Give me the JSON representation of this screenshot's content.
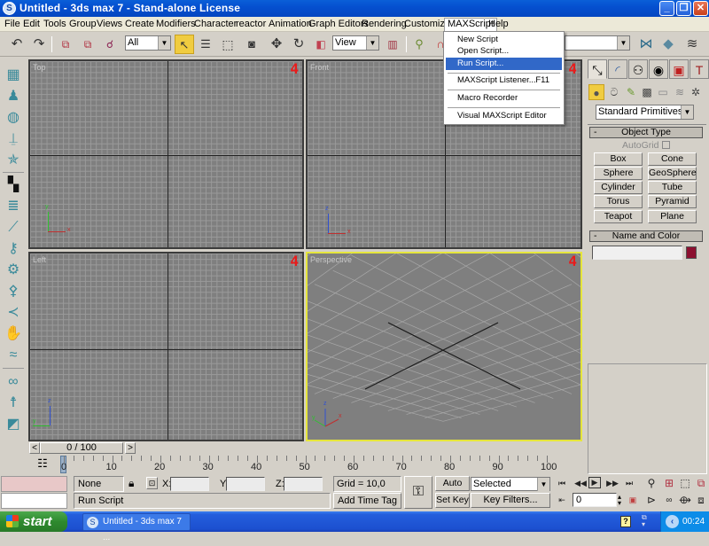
{
  "window": {
    "title": "Untitled - 3ds max 7  - Stand-alone License",
    "app_icon": "3ds-max-logo-icon",
    "controls": [
      "minimize",
      "restore",
      "close"
    ]
  },
  "menubar": {
    "items": [
      "File",
      "Edit",
      "Tools",
      "Group",
      "Views",
      "Create",
      "Modifiers",
      "Character",
      "reactor",
      "Animation",
      "Graph Editors",
      "Rendering",
      "Customize",
      "MAXScript",
      "Help"
    ],
    "open_menu": "MAXScript"
  },
  "maxscript_menu": {
    "items": [
      {
        "label": "New Script",
        "shortcut": ""
      },
      {
        "label": "Open Script...",
        "shortcut": ""
      },
      {
        "label": "Run Script...",
        "shortcut": "",
        "highlighted": true
      },
      {
        "label": "MAXScript Listener...",
        "shortcut": "F11"
      },
      {
        "label": "Macro Recorder",
        "shortcut": ""
      },
      {
        "label": "Visual MAXScript Editor",
        "shortcut": ""
      }
    ]
  },
  "toolbar": {
    "selection_filter": "All",
    "ref_coord_system": "View",
    "named_selection": "",
    "icons": [
      "undo-icon",
      "redo-icon",
      "select-and-link-icon",
      "unlink-icon",
      "bind-space-warp-icon",
      "select-object-icon",
      "select-by-name-icon",
      "rectangular-selection-icon",
      "window-crossing-icon",
      "move-icon",
      "rotate-icon",
      "scale-icon",
      "pivot-center-icon",
      "manipulate-icon",
      "snap-icon",
      "mirror-icon",
      "align-icon",
      "layer-manager-icon"
    ]
  },
  "left_strip": {
    "icons": [
      "create-geometry-icon",
      "shirt-icon",
      "sphere-ball-icon",
      "plane-icon",
      "figure-icon",
      "checker-icon",
      "spring-icon",
      "tube-icon",
      "wrench-icon",
      "gear-icon",
      "weathervane-icon",
      "fish-icon",
      "hand-icon",
      "waves-icon",
      "knot-icon",
      "biped-icon",
      "bucket-icon",
      "dumbbell-icon",
      "bottle-icon"
    ]
  },
  "viewports": [
    {
      "label": "Top",
      "number": "4",
      "axes": [
        "y",
        "x",
        "z"
      ],
      "active": false
    },
    {
      "label": "Front",
      "number": "4",
      "axes": [
        "z",
        "x",
        "y"
      ],
      "active": false
    },
    {
      "label": "Left",
      "number": "4",
      "axes": [
        "z",
        "y",
        "x"
      ],
      "active": false
    },
    {
      "label": "Perspective",
      "number": "4",
      "axes": [
        "z",
        "y",
        "x"
      ],
      "active": true
    }
  ],
  "command_panel": {
    "tabs": [
      "create-tab-icon",
      "modify-tab-icon",
      "hierarchy-tab-icon",
      "motion-tab-icon",
      "display-tab-icon",
      "utilities-tab-icon"
    ],
    "subcategories": [
      "geometry-icon",
      "shapes-icon",
      "lights-icon",
      "cameras-icon",
      "helpers-icon",
      "space-warps-icon",
      "systems-icon"
    ],
    "category_dropdown": "Standard Primitives",
    "object_type": {
      "header": "Object Type",
      "autogrid_label": "AutoGrid",
      "autogrid_checked": false,
      "buttons": [
        "Box",
        "Cone",
        "Sphere",
        "GeoSphere",
        "Cylinder",
        "Tube",
        "Torus",
        "Pyramid",
        "Teapot",
        "Plane"
      ]
    },
    "name_and_color": {
      "header": "Name and Color",
      "name_value": "",
      "color": "#8c1030"
    },
    "collapse_symbol": "-"
  },
  "time_slider": {
    "prev": "<",
    "next": ">",
    "label": "0 / 100",
    "ticks": [
      "0",
      "10",
      "20",
      "30",
      "40",
      "50",
      "60",
      "70",
      "80",
      "90",
      "100"
    ],
    "current_frame": 0
  },
  "status": {
    "selection": "None Select",
    "x_label": "X:",
    "y_label": "Y:",
    "z_label": "Z:",
    "x_value": "",
    "y_value": "",
    "z_value": "",
    "grid": "Grid = 10,0",
    "prompt": "Run Script",
    "add_time_tag": "Add Time Tag"
  },
  "animation": {
    "auto_key": "Auto Key",
    "set_key": "Set Key",
    "key_mode": "Selected",
    "key_filters": "Key Filters...",
    "frame": "0"
  },
  "taskbar": {
    "start": "start",
    "task_item": "Untitled - 3ds max 7  ...",
    "clock": "00:24"
  }
}
